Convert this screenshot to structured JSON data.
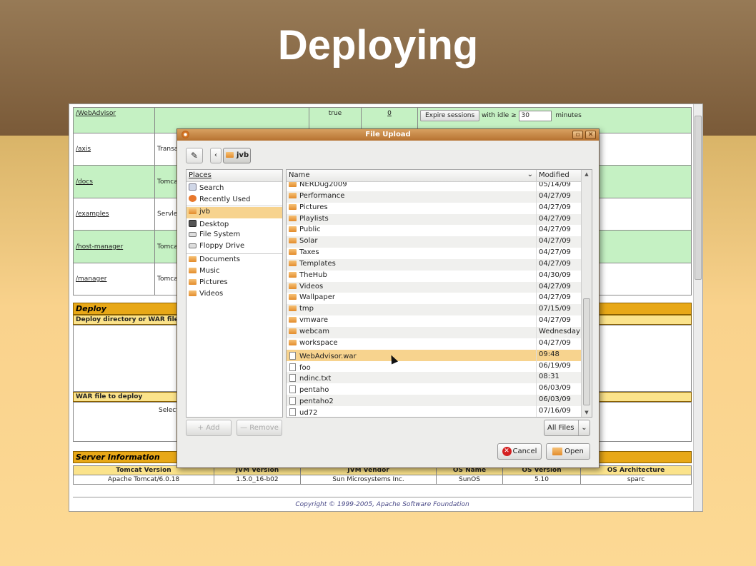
{
  "slide": {
    "title": "Deploying"
  },
  "apps": [
    {
      "path": "/WebAdvisor",
      "name": "",
      "running": "true",
      "sessions": "0",
      "green": true
    },
    {
      "path": "/axis",
      "name": "Transa",
      "green": false
    },
    {
      "path": "/docs",
      "name": "Tomca",
      "green": true
    },
    {
      "path": "/examples",
      "name": "Servlet",
      "green": false
    },
    {
      "path": "/host-manager",
      "name": "Tomca",
      "green": true
    },
    {
      "path": "/manager",
      "name": "Tomca",
      "green": false
    }
  ],
  "expire": {
    "button": "Expire sessions",
    "prefix": "with idle ≥",
    "value": "30",
    "suffix": "minutes"
  },
  "deploy": {
    "title": "Deploy",
    "dir_label": "Deploy directory or WAR file",
    "war_label": "WAR file to deploy",
    "select_label": "Select"
  },
  "server": {
    "title": "Server Information",
    "headers": [
      "Tomcat Version",
      "JVM Version",
      "JVM Vendor",
      "OS Name",
      "OS Version",
      "OS Architecture"
    ],
    "values": [
      "Apache Tomcat/6.0.18",
      "1.5.0_16-b02",
      "Sun Microsystems Inc.",
      "SunOS",
      "5.10",
      "sparc"
    ]
  },
  "copyright": "Copyright © 1999-2005, Apache Software Foundation",
  "dialog": {
    "title": "File Upload",
    "crumb": "jvb",
    "places_header": "Places",
    "places": [
      {
        "label": "Search",
        "icon": "search-icon"
      },
      {
        "label": "Recently Used",
        "icon": "recent-icon"
      },
      {
        "label": "jvb",
        "icon": "home-folder-icon",
        "selected": true
      },
      {
        "label": "Desktop",
        "icon": "desktop-icon"
      },
      {
        "label": "File System",
        "icon": "drive-icon"
      },
      {
        "label": "Floppy Drive",
        "icon": "floppy-icon"
      }
    ],
    "bookmarks": [
      "Documents",
      "Music",
      "Pictures",
      "Videos"
    ],
    "col_name": "Name",
    "col_modified": "Modified",
    "files": [
      {
        "name": "NERDug2009",
        "date": "05/14/09",
        "type": "folder"
      },
      {
        "name": "Performance",
        "date": "04/27/09",
        "type": "folder"
      },
      {
        "name": "Pictures",
        "date": "04/27/09",
        "type": "folder"
      },
      {
        "name": "Playlists",
        "date": "04/27/09",
        "type": "folder"
      },
      {
        "name": "Public",
        "date": "04/27/09",
        "type": "folder"
      },
      {
        "name": "Solar",
        "date": "04/27/09",
        "type": "folder"
      },
      {
        "name": "Taxes",
        "date": "04/27/09",
        "type": "folder"
      },
      {
        "name": "Templates",
        "date": "04/27/09",
        "type": "folder"
      },
      {
        "name": "TheHub",
        "date": "04/30/09",
        "type": "folder"
      },
      {
        "name": "Videos",
        "date": "04/27/09",
        "type": "folder"
      },
      {
        "name": "Wallpaper",
        "date": "04/27/09",
        "type": "folder"
      },
      {
        "name": "tmp",
        "date": "07/15/09",
        "type": "folder"
      },
      {
        "name": "vmware",
        "date": "04/27/09",
        "type": "folder"
      },
      {
        "name": "webcam",
        "date": "Wednesday",
        "type": "folder"
      },
      {
        "name": "workspace",
        "date": "04/27/09",
        "type": "folder"
      },
      {
        "name": "WebAdvisor.war",
        "date": "09:48",
        "type": "file",
        "selected": true
      },
      {
        "name": "foo",
        "date": "06/19/09",
        "type": "file"
      },
      {
        "name": "ndinc.txt",
        "date": "08:31",
        "type": "file"
      },
      {
        "name": "pentaho",
        "date": "06/03/09",
        "type": "file"
      },
      {
        "name": "pentaho2",
        "date": "06/03/09",
        "type": "file"
      },
      {
        "name": "ud72",
        "date": "07/16/09",
        "type": "file"
      }
    ],
    "add_label": "Add",
    "remove_label": "Remove",
    "filter": "All Files",
    "cancel_label": "Cancel",
    "open_label": "Open"
  }
}
